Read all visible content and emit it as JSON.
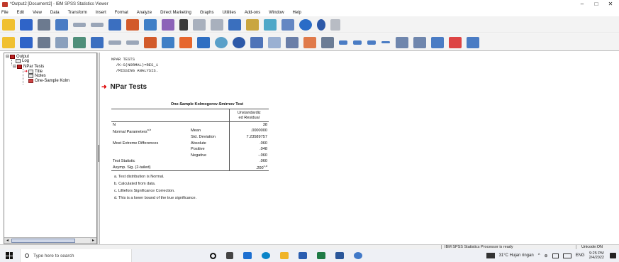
{
  "window": {
    "title": "*Output2 [Document2] - IBM SPSS Statistics Viewer",
    "controls": [
      "–",
      "□",
      "✕"
    ]
  },
  "menu": [
    "File",
    "Edit",
    "View",
    "Data",
    "Transform",
    "Insert",
    "Format",
    "Analyze",
    "Direct Marketing",
    "Graphs",
    "Utilities",
    "Add-ons",
    "Window",
    "Help"
  ],
  "outline": {
    "root": "Output",
    "log": "Log",
    "npar": "NPar Tests",
    "title": "Title",
    "notes": "Notes",
    "ks": "One-Sample Kolm"
  },
  "syntax": {
    "line1": "NPAR TESTS",
    "line2": "  /K-S(NORMAL)=RES_1",
    "line3": "  /MISSING ANALYSIS."
  },
  "heading": "NPar Tests",
  "ks_table": {
    "title": "One-Sample Kolmogorov-Smirnov Test",
    "col_header_1": "Unstandardiz",
    "col_header_2": "ed Residual",
    "rows": {
      "n_label": "N",
      "n_value": "38",
      "np_label": "Normal Parameters",
      "np_sup": "a,b",
      "mean_label": "Mean",
      "mean_value": ".0000000",
      "sd_label": "Std. Deviation",
      "sd_value": "7.23589757",
      "med_label": "Most Extreme Differences",
      "abs_label": "Absolute",
      "abs_value": ".060",
      "pos_label": "Positive",
      "pos_value": ".048",
      "neg_label": "Negative",
      "neg_value": "-.060",
      "ts_label": "Test Statistic",
      "ts_value": ".060",
      "sig_label": "Asymp. Sig. (2-tailed)",
      "sig_value": ".200",
      "sig_sup": "c,d"
    },
    "footnotes": {
      "a": "a. Test distribution is Normal.",
      "b": "b. Calculated from data.",
      "c": "c. Lilliefors Significance Correction.",
      "d": "d. This is a lower bound of the true significance."
    }
  },
  "statusbar": {
    "processor": "IBM SPSS Statistics Processor is ready",
    "encoding": "Unicode:ON"
  },
  "taskbar": {
    "search_placeholder": "Type here to search",
    "weather": "31°C  Hujan ringan",
    "language": "ENG",
    "time": "9:25 PM",
    "date": "2/4/2022"
  },
  "colors": {
    "accent_red": "#d00000",
    "toolbar_bg": "#f3f3f3"
  }
}
